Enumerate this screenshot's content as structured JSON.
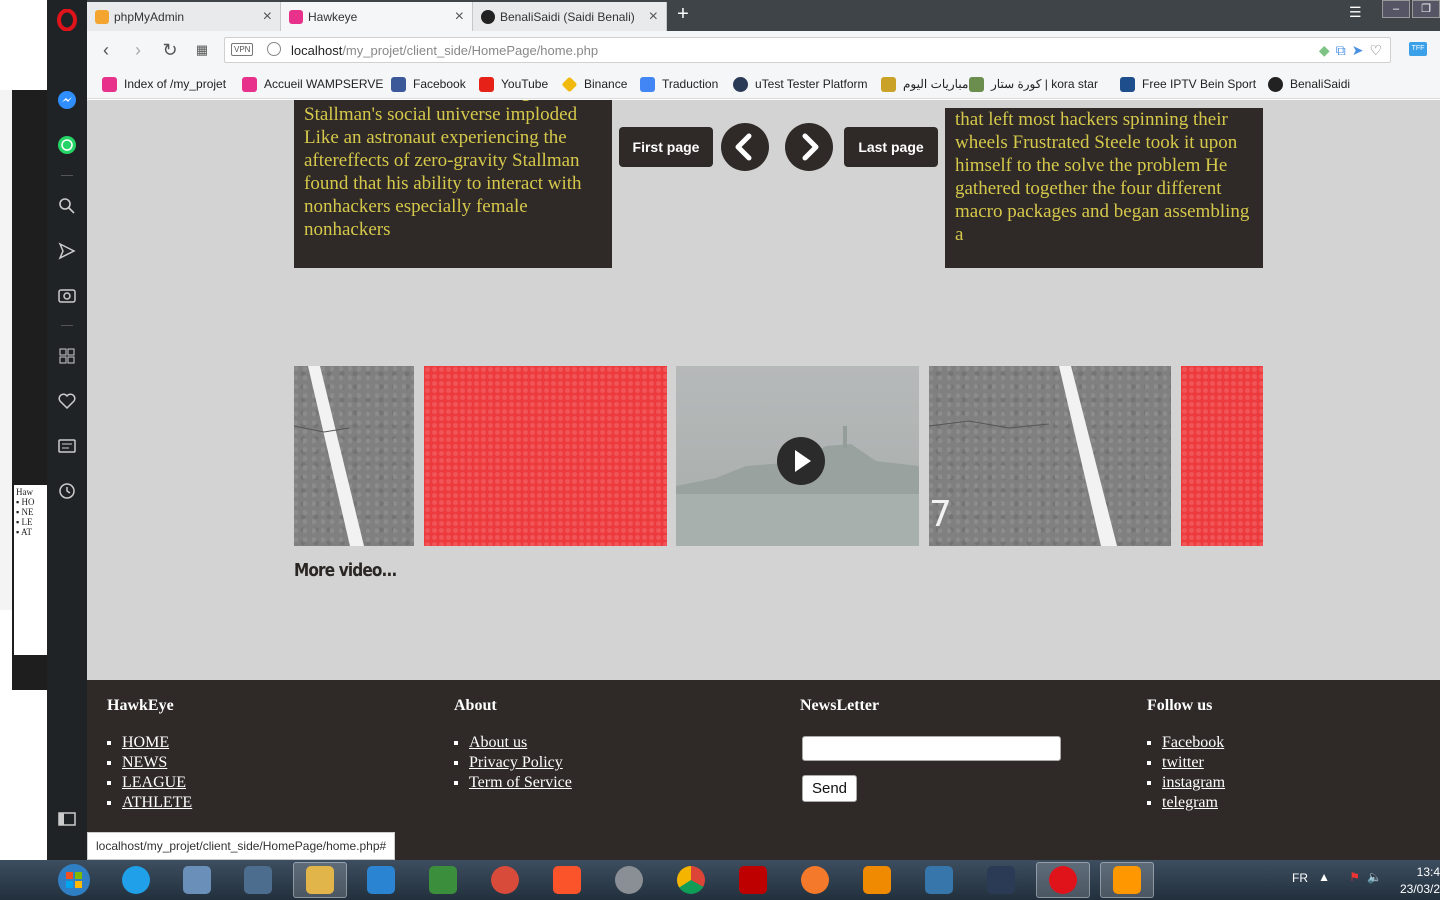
{
  "tabs": [
    {
      "title": "phpMyAdmin",
      "favicon": "phpmyadmin-icon"
    },
    {
      "title": "Hawkeye",
      "favicon": "wamp-icon"
    },
    {
      "title": "BenaliSaidi (Saidi Benali)",
      "favicon": "github-icon"
    }
  ],
  "address_bar": {
    "vpn_label": "VPN",
    "url_host": "localhost",
    "url_path": "/my_projet/client_side/HomePage/home.php"
  },
  "bookmarks": [
    "Index of /my_projet",
    "Accueil WAMPSERVE",
    "Facebook",
    "YouTube",
    "Binance",
    "Traduction",
    "uTest Tester Platform",
    "مباريات اليوم",
    "كورة ستار | kora star",
    "Free IPTV Bein Sport",
    "BenaliSaidi"
  ],
  "page": {
    "left_article": "With no dorm and no dancing Stallman's social universe imploded Like an astronaut experiencing the aftereffects of zero-gravity Stallman found that his ability to interact with nonhackers especially female nonhackers",
    "right_article": "that left most hackers spinning their wheels Frustrated Steele took it upon himself to the solve the problem He gathered together the four different macro packages and began assembling a",
    "pagination": {
      "first": "First page",
      "last": "Last page"
    },
    "more_video": "More video..."
  },
  "footer": {
    "brand": {
      "title": "HawkEye",
      "links": [
        "HOME",
        "NEWS",
        "LEAGUE",
        "ATHLETE"
      ]
    },
    "about": {
      "title": "About",
      "links": [
        "About us",
        "Privacy Policy",
        "Term of Service"
      ]
    },
    "newsletter": {
      "title": "NewsLetter",
      "input_value": "",
      "send_label": "Send"
    },
    "follow": {
      "title": "Follow us",
      "links": [
        "Facebook",
        "twitter",
        "instagram",
        "telegram"
      ]
    }
  },
  "status_bar_url": "localhost/my_projet/client_side/HomePage/home.php#",
  "taskbar": {
    "language": "FR",
    "time": "13:4",
    "date": "23/03/2"
  },
  "colors": {
    "page_bg": "#d3d3d3",
    "dark_panel": "#2f2a28",
    "article_text": "#d5c84a",
    "opera_red": "#e0131a"
  }
}
